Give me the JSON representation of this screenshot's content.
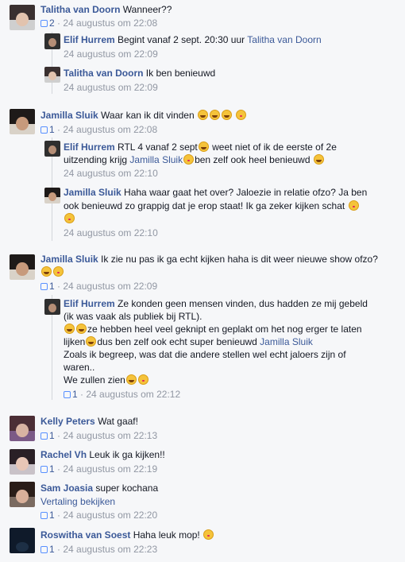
{
  "colors": {
    "accent": "#3b5998",
    "meta": "#9197a3",
    "bg": "#f6f7f9"
  },
  "icons": {
    "like": "thumb-like-icon",
    "laugh": "laughing-emoji-icon",
    "kiss": "kiss-emoji-icon",
    "blush": "blushing-emoji-icon"
  },
  "sep": "·",
  "c1": {
    "name": "Talitha van Doorn",
    "text": "Wanneer??",
    "likes": "2",
    "time": "24 augustus om 22:08",
    "r1": {
      "name": "Elif Hurrem",
      "text": "Begint vanaf 2 sept. 20:30 uur",
      "mention": "Talitha van Doorn",
      "time": "24 augustus om 22:09"
    },
    "r2": {
      "name": "Talitha van Doorn",
      "text": "Ik ben benieuwd",
      "time": "24 augustus om 22:09"
    }
  },
  "c2": {
    "name": "Jamilla Sluik",
    "text": "Waar kan ik dit vinden",
    "likes": "1",
    "time": "24 augustus om 22:08",
    "r1": {
      "name": "Elif Hurrem",
      "text1": "RTL 4 vanaf 2 sept",
      "text2": "weet niet of ik de eerste of 2e",
      "line2": "uitzending krijg",
      "mention": "Jamilla Sluik",
      "text3": "ben zelf ook heel benieuwd",
      "time": "24 augustus om 22:10"
    },
    "r2": {
      "name": "Jamilla Sluik",
      "text1": "Haha waar gaat het over? Jaloezie in relatie ofzo? Ja ben",
      "line2": "ook benieuwd zo grappig dat je erop staat! Ik ga zeker kijken schat",
      "time": "24 augustus om 22:10"
    }
  },
  "c3": {
    "name": "Jamilla Sluik",
    "text": "Ik zie nu pas ik ga echt kijken haha is dit weer nieuwe show ofzo?",
    "likes": "1",
    "time": "24 augustus om 22:09",
    "r1": {
      "name": "Elif Hurrem",
      "text1": "Ze konden geen mensen vinden, dus hadden ze mij gebeld",
      "line2": "(ik was vaak als publiek bij RTL).",
      "line3": "ze hebben heel veel geknipt en geplakt om het nog erger te laten",
      "line4a": "lijken",
      "line4b": "dus ben zelf ook echt super benieuwd",
      "mention": "Jamilla Sluik",
      "line5": "Zoals ik begreep, was dat die andere stellen wel echt jaloers zijn of",
      "line6": "waren..",
      "line7": "We zullen zien",
      "likes": "1",
      "time": "24 augustus om 22:12"
    }
  },
  "c4": {
    "name": "Kelly Peters",
    "text": "Wat gaaf!",
    "likes": "1",
    "time": "24 augustus om 22:13"
  },
  "c5": {
    "name": "Rachel Vh",
    "text": "Leuk ik ga kijken!!",
    "likes": "1",
    "time": "24 augustus om 22:19"
  },
  "c6": {
    "name": "Sam Joasia",
    "text": "super kochana",
    "translate": "Vertaling bekijken",
    "likes": "1",
    "time": "24 augustus om 22:20"
  },
  "c7": {
    "name": "Roswitha van Soest",
    "text": "Haha leuk mop!",
    "likes": "1",
    "time": "24 augustus om 22:23"
  }
}
